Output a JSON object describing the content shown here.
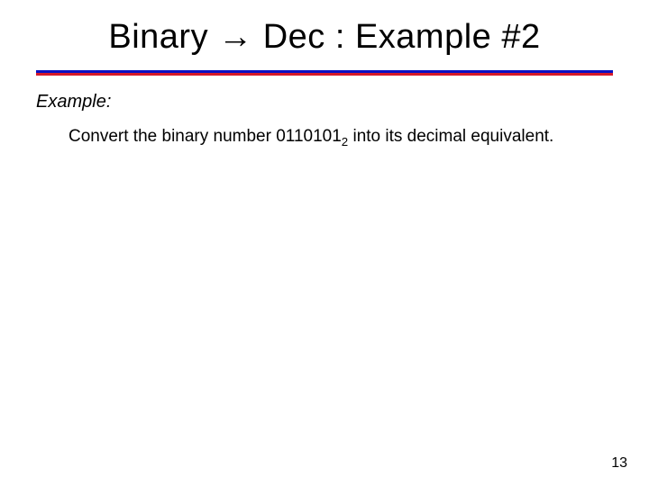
{
  "slide": {
    "title": "Binary → Dec : Example #2",
    "example_label": "Example:",
    "body_prefix": "Convert the binary number ",
    "binary_digits": "0110101",
    "binary_base": "2",
    "body_suffix": " into its decimal equivalent.",
    "page_number": "13"
  }
}
